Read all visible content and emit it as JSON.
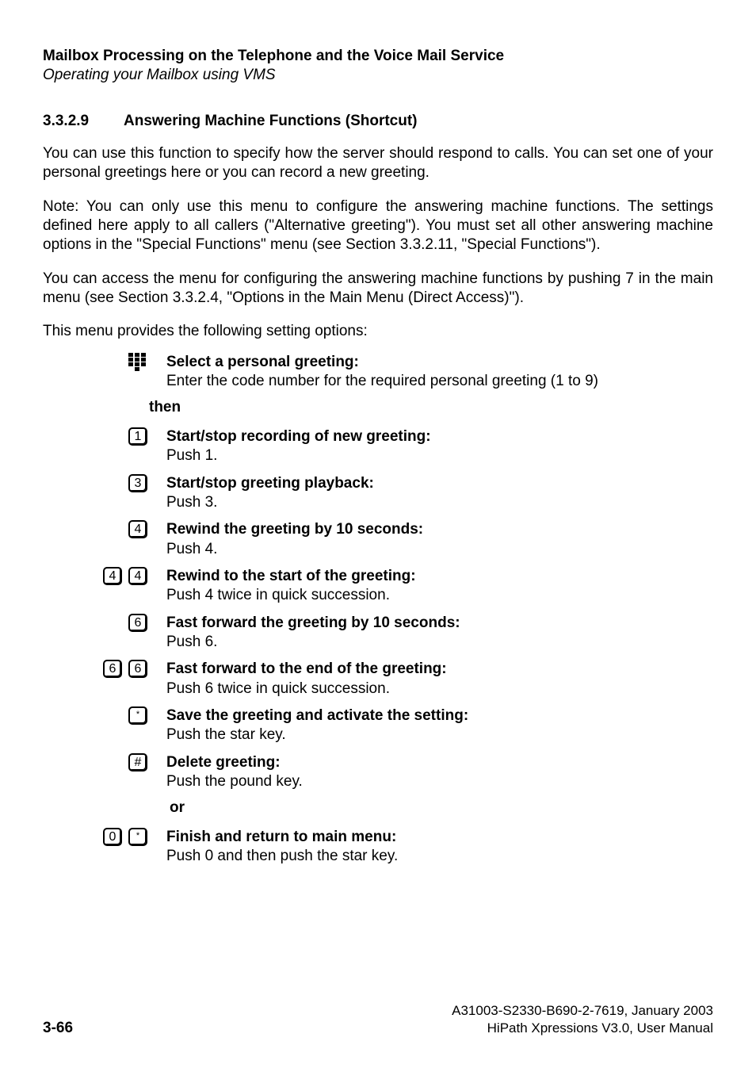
{
  "header": {
    "title": "Mailbox Processing on the Telephone and the Voice Mail Service",
    "subtitle": "Operating your Mailbox using VMS"
  },
  "section": {
    "number": "3.3.2.9",
    "title": "Answering Machine Functions (Shortcut)"
  },
  "paragraphs": {
    "p1": "You can use this function to specify how the server should respond to calls. You can set one of your personal greetings here or you can record a new greeting.",
    "p2": "Note: You can only use this menu to configure the answering machine functions. The settings defined here apply to all callers (\"Alternative greeting\"). You must set all other answering machine options in the \"Special Functions\" menu (see Section 3.3.2.11, \"Special Functions\").",
    "p3": "You can access the menu for configuring the answering machine functions by pushing 7 in the main menu (see Section 3.3.2.4, \"Options in the Main Menu (Direct Access)\").",
    "p4": "This menu provides the following setting options:"
  },
  "items": [
    {
      "leftKey": "",
      "icon": "keypad",
      "title": "Select a personal greeting:",
      "desc": "Enter the code number for the required personal greeting (1 to 9)"
    }
  ],
  "then_label": "then",
  "items2": [
    {
      "leftKey": "",
      "rightKey": "1",
      "title": "Start/stop recording of new greeting:",
      "desc": "Push 1."
    },
    {
      "leftKey": "",
      "rightKey": "3",
      "title": "Start/stop greeting playback:",
      "desc": "Push 3."
    },
    {
      "leftKey": "",
      "rightKey": "4",
      "title": "Rewind the greeting by 10 seconds:",
      "desc": "Push 4."
    },
    {
      "leftKey": "4",
      "rightKey": "4",
      "title": "Rewind to the start of the greeting:",
      "desc": "Push 4 twice in quick succession."
    },
    {
      "leftKey": "",
      "rightKey": "6",
      "title": "Fast forward the greeting by 10 seconds:",
      "desc": "Push 6."
    },
    {
      "leftKey": "6",
      "rightKey": "6",
      "title": "Fast forward to the end of the greeting:",
      "desc": "Push 6 twice in quick succession."
    },
    {
      "leftKey": "",
      "rightKey": "*",
      "title": "Save the greeting and activate the setting:",
      "desc": "Push the star key."
    },
    {
      "leftKey": "",
      "rightKey": "#",
      "title": "Delete greeting:",
      "desc": "Push the pound key."
    }
  ],
  "or_label": "or",
  "items3": [
    {
      "leftKey": "0",
      "rightKey": "*",
      "title": "Finish and return to main menu:",
      "desc": "Push 0 and then push the star key."
    }
  ],
  "footer": {
    "docid": "A31003-S2330-B690-2-7619, January 2003",
    "product": "HiPath Xpressions V3.0, User Manual",
    "page": "3-66"
  }
}
